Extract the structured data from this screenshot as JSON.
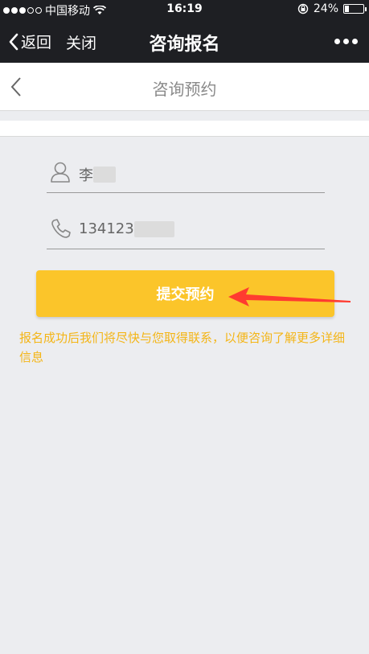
{
  "status_bar": {
    "carrier": "中国移动",
    "time": "16:19",
    "battery": "24%",
    "battery_level": 0.24
  },
  "nav_bar": {
    "back_label": "返回",
    "close_label": "关闭",
    "title": "咨询报名"
  },
  "page": {
    "title": "咨询预约"
  },
  "form": {
    "name_value": "李",
    "phone_value": "134123",
    "submit_label": "提交预约",
    "hint": "报名成功后我们将尽快与您取得联系，以便咨询了解更多详细信息"
  },
  "colors": {
    "accent": "#fbc52a",
    "hint": "#f4b516",
    "annotation_arrow": "#ff3b30"
  }
}
